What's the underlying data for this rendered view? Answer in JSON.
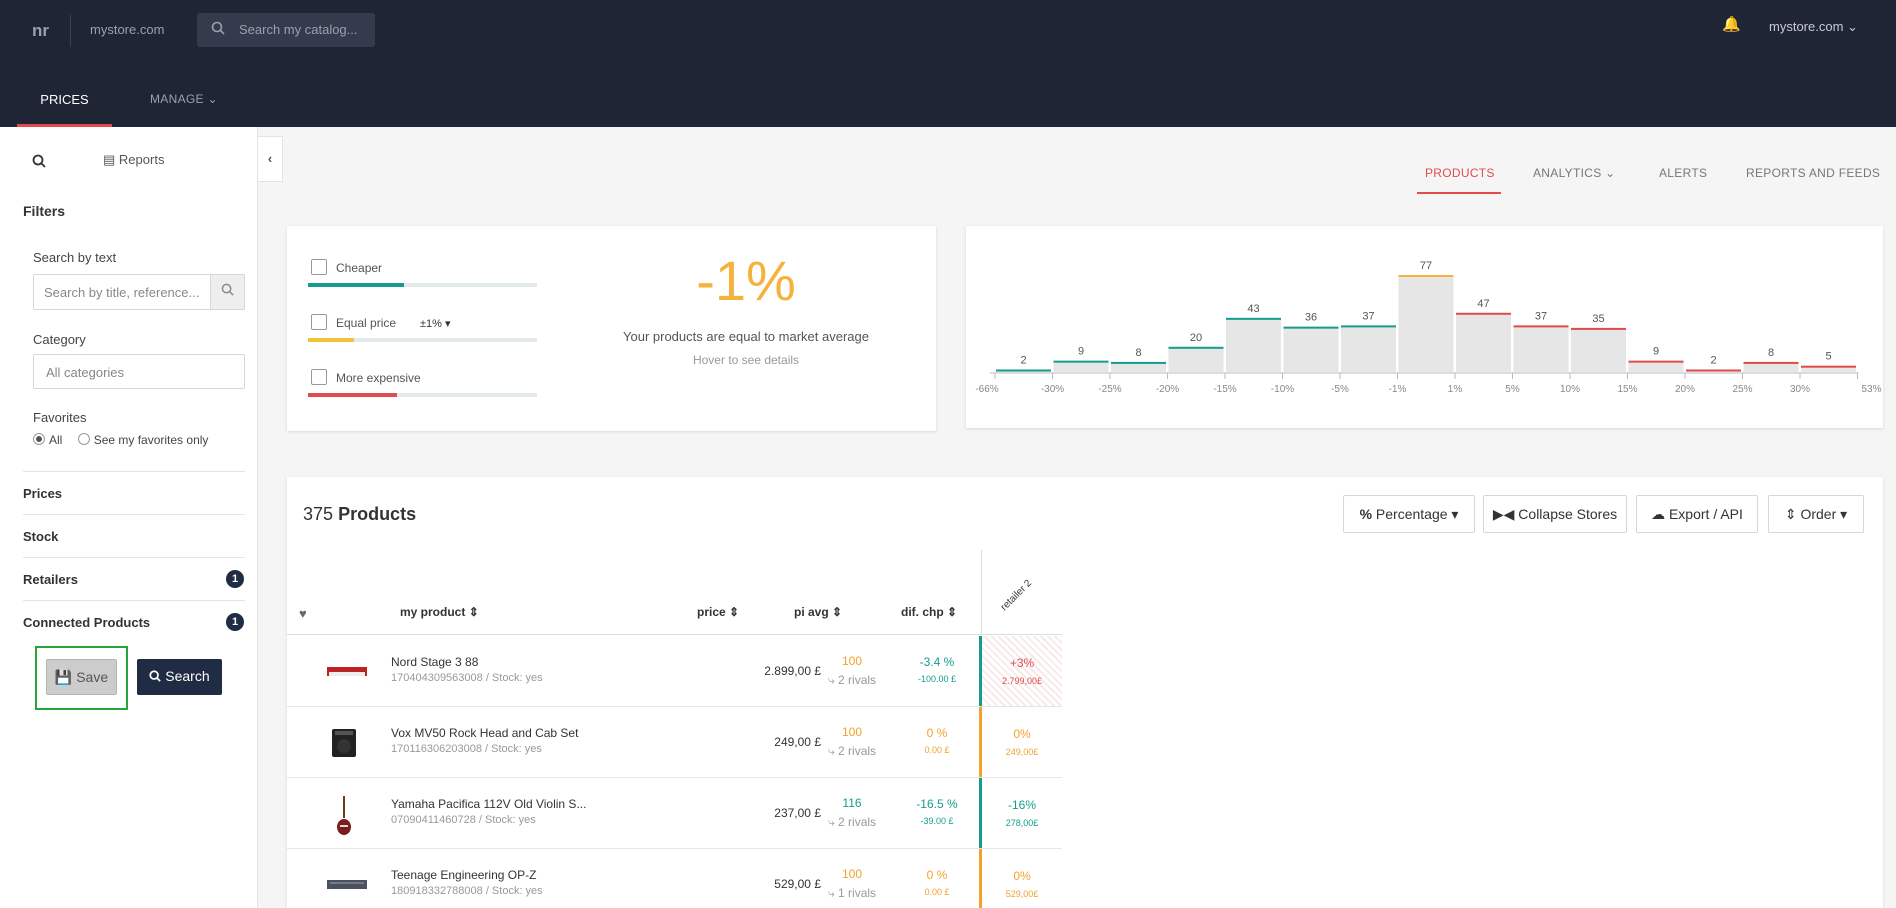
{
  "topbar": {
    "logo": "nr",
    "store": "mystore.com",
    "search_placeholder": "Search my catalog...",
    "store_menu": "mystore.com",
    "tabs": {
      "prices": "PRICES",
      "manage": "MANAGE"
    }
  },
  "sidebar": {
    "reports": "Reports",
    "filters": "Filters",
    "search_by_text": "Search by text",
    "search_placeholder": "Search by title, reference...",
    "category": "Category",
    "category_value": "All categories",
    "favorites": "Favorites",
    "fav_all": "All",
    "fav_mine": "See my favorites only",
    "sections": [
      {
        "label": "Prices"
      },
      {
        "label": "Stock"
      },
      {
        "label": "Retailers",
        "badge": "1"
      },
      {
        "label": "Connected Products",
        "badge": "1"
      }
    ],
    "save": "Save",
    "search": "Search"
  },
  "nav": {
    "products": "PRODUCTS",
    "analytics": "ANALYTICS",
    "alerts": "ALERTS",
    "reports": "REPORTS AND FEEDS"
  },
  "summary": {
    "cheaper": "Cheaper",
    "equal": "Equal price",
    "equal_range": "±1%",
    "expensive": "More expensive",
    "big_value": "-1%",
    "text": "Your products are equal to market average",
    "hover": "Hover to see details",
    "bars": {
      "cheaper": 0.42,
      "equal": 0.2,
      "expensive": 0.39
    }
  },
  "chart_data": {
    "type": "bar",
    "values": [
      2,
      9,
      8,
      20,
      43,
      36,
      37,
      77,
      47,
      37,
      35,
      9,
      2,
      8,
      5
    ],
    "colors": [
      "#169c8e",
      "#169c8e",
      "#169c8e",
      "#169c8e",
      "#169c8e",
      "#169c8e",
      "#169c8e",
      "#f3b33d",
      "#e24b4b",
      "#e24b4b",
      "#e24b4b",
      "#e24b4b",
      "#e24b4b",
      "#e24b4b",
      "#e24b4b"
    ],
    "tick_labels": [
      "-66%",
      "-30%",
      "-25%",
      "-20%",
      "-15%",
      "-10%",
      "-5%",
      "-1%",
      "1%",
      "5%",
      "10%",
      "15%",
      "20%",
      "25%",
      "30%",
      "53%"
    ]
  },
  "products": {
    "count": "375",
    "label": "Products",
    "toolbar": {
      "percentage": "Percentage",
      "collapse": "Collapse Stores",
      "export": "Export / API",
      "order": "Order"
    },
    "headers": {
      "product": "my product",
      "price": "price",
      "pi": "pi avg",
      "dif": "dif. chp",
      "retailer": "retailer 2"
    },
    "rows": [
      {
        "name": "Nord Stage 3 88",
        "sub": "170404309563008 / Stock: yes",
        "price": "2.899,00 £",
        "pi": "100",
        "rivals": "2 rivals",
        "dif": "-3.4 %",
        "dif_sub": "-100.00 £",
        "cell": "+3%",
        "cell_sub": "2.799,00£",
        "color": "red",
        "thumb": "keyboard"
      },
      {
        "name": "Vox MV50 Rock Head and Cab Set",
        "sub": "170116306203008 / Stock: yes",
        "price": "249,00 £",
        "pi": "100",
        "rivals": "2 rivals",
        "dif": "0 %",
        "dif_sub": "0.00 £",
        "cell": "0%",
        "cell_sub": "249,00£",
        "color": "orange",
        "thumb": "amp"
      },
      {
        "name": "Yamaha Pacifica 112V Old Violin S...",
        "sub": "07090411460728 / Stock: yes",
        "price": "237,00 £",
        "pi": "116",
        "rivals": "2 rivals",
        "dif": "-16.5 %",
        "dif_sub": "-39.00 £",
        "cell": "-16%",
        "cell_sub": "278,00£",
        "color": "green",
        "thumb": "guitar"
      },
      {
        "name": "Teenage Engineering OP-Z",
        "sub": "180918332788008 / Stock: yes",
        "price": "529,00 £",
        "pi": "100",
        "rivals": "1 rivals",
        "dif": "0 %",
        "dif_sub": "0.00 £",
        "cell": "0%",
        "cell_sub": "529,00£",
        "color": "orange",
        "thumb": "synth"
      }
    ]
  }
}
